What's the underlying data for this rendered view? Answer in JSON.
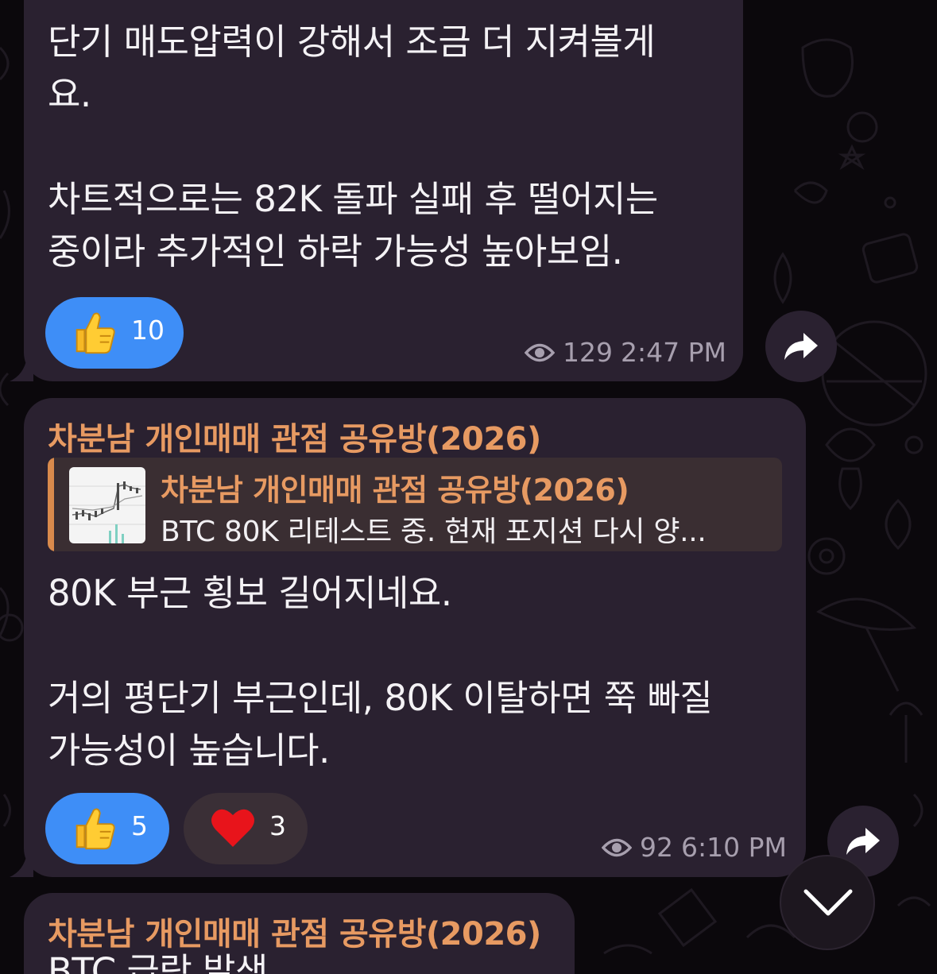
{
  "messages": [
    {
      "text": "단기 매도압력이 강해서 조금 더 지켜볼게\n요.\n\n차트적으로는 82K 돌파 실패 후 떨어지는\n중이라 추가적인 하락 가능성 높아보임.",
      "reactions": [
        {
          "emoji": "thumbs-up-icon",
          "count": "10"
        }
      ],
      "views": "129",
      "time": "2:47 PM"
    },
    {
      "sender": "차분남 개인매매 관점 공유방(2026)",
      "reply": {
        "sender": "차분남 개인매매 관점 공유방(2026)",
        "text": "BTC 80K 리테스트 중. 현재 포지션 다시 양..."
      },
      "text": "80K 부근 횡보 길어지네요.\n\n거의 평단기 부근인데, 80K 이탈하면 쭉 빠질\n가능성이 높습니다.",
      "reactions": [
        {
          "emoji": "thumbs-up-icon",
          "count": "5"
        },
        {
          "emoji": "heart-icon",
          "count": "3"
        }
      ],
      "views": "92",
      "time": "6:10 PM"
    },
    {
      "sender": "차분남 개인매매 관점 공유방(2026)",
      "text": "BTC 급락 발생"
    }
  ],
  "colors": {
    "background": "#0b080c",
    "bubble": "#2a2130",
    "sender_accent": "#e79a62",
    "reaction_chosen": "#3e8ef7",
    "meta_text": "#a79fae"
  },
  "icons": {
    "views": "eye-icon",
    "share": "share-arrow-icon",
    "scroll": "chevron-down-icon"
  }
}
